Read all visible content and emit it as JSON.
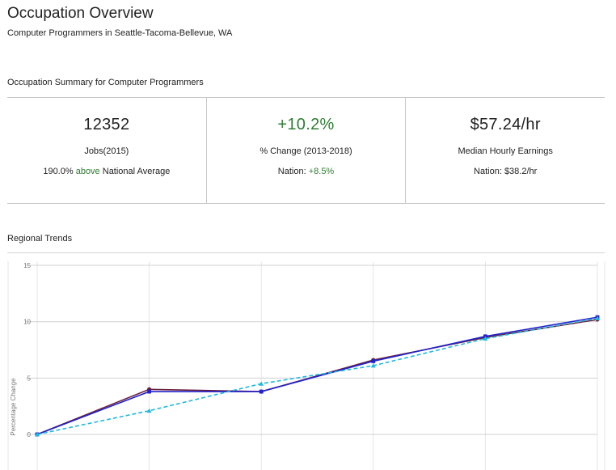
{
  "header": {
    "title": "Occupation Overview",
    "subtitle": "Computer Programmers in Seattle-Tacoma-Bellevue, WA"
  },
  "summary": {
    "heading": "Occupation Summary for Computer Programmers",
    "jobs": {
      "value": "12352",
      "label": "Jobs(2015)",
      "note_pct": "190.0%",
      "note_word": "above",
      "note_rest": "National Average"
    },
    "change": {
      "value": "+10.2%",
      "label": "% Change (2013-2018)",
      "note_prefix": "Nation:",
      "note_value": "+8.5%"
    },
    "earnings": {
      "value": "$57.24/hr",
      "label": "Median Hourly Earnings",
      "note": "Nation: $38.2/hr"
    }
  },
  "trends": {
    "heading": "Regional Trends"
  },
  "colors": {
    "accent_green": "#2e7d32",
    "series_maroon": "#6b1f3a",
    "series_blue": "#2222cc",
    "series_cyan": "#22b8e0",
    "grid": "#e6e6e6"
  },
  "chart_data": {
    "type": "line",
    "ylabel": "Percentage Change",
    "yticks": [
      "0",
      "5",
      "10",
      "15"
    ],
    "ylim": [
      -3,
      15
    ],
    "x_count": 6,
    "grid": true,
    "series": [
      {
        "color": "#6b1f3a",
        "dash": false,
        "marker": "circle",
        "values": [
          0,
          4.0,
          3.8,
          6.6,
          8.6,
          10.2
        ]
      },
      {
        "color": "#2222cc",
        "dash": false,
        "marker": "square",
        "values": [
          0,
          3.8,
          3.8,
          6.5,
          8.7,
          10.4
        ]
      },
      {
        "color": "#22b8e0",
        "dash": true,
        "marker": "triangle",
        "values": [
          0,
          2.1,
          4.5,
          6.1,
          8.5,
          10.3
        ]
      }
    ]
  }
}
